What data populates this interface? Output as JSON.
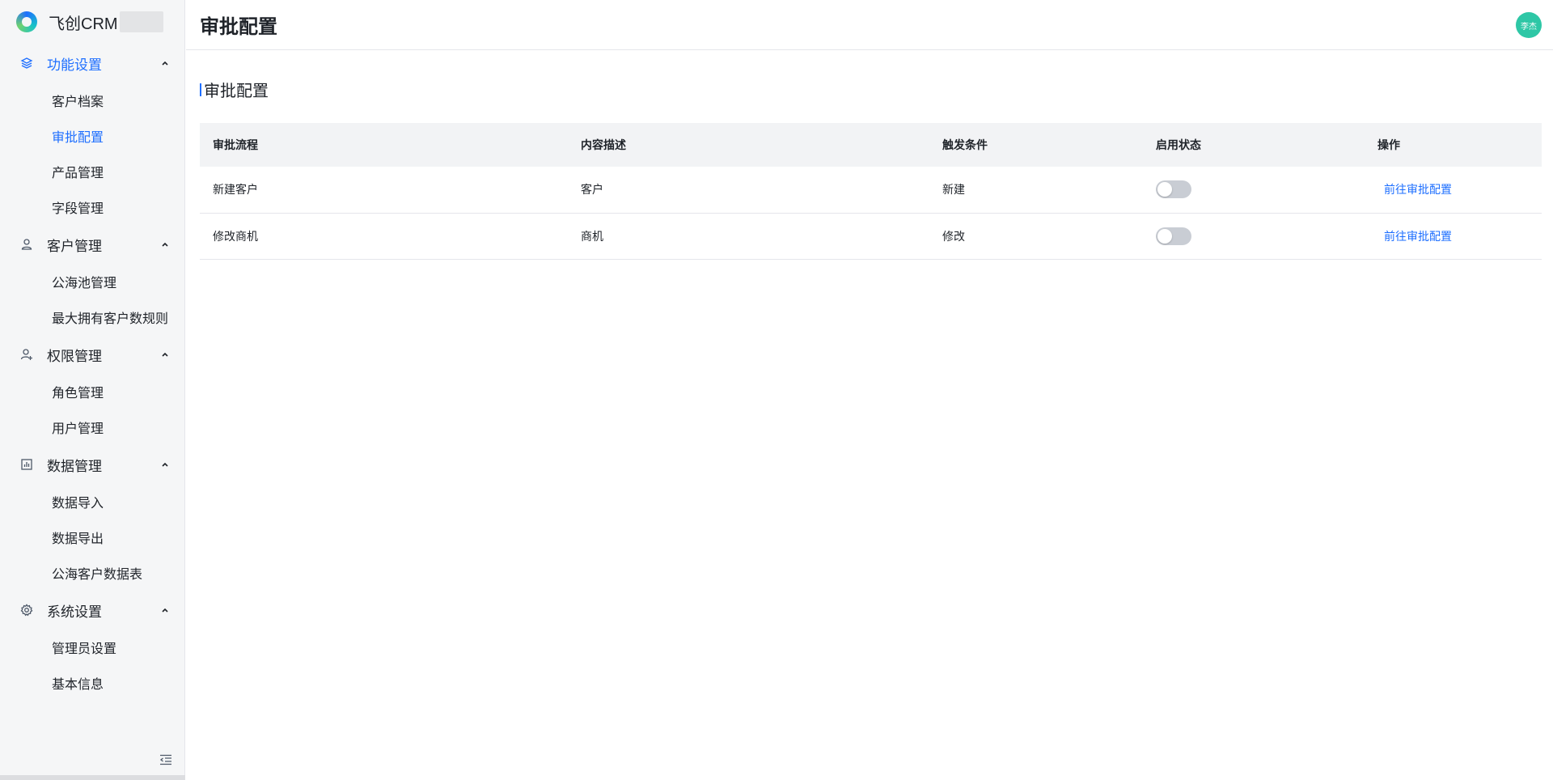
{
  "brand": {
    "name": "飞创CRM"
  },
  "sidebar": {
    "groups": [
      {
        "label": "功能设置",
        "icon": "layers-icon",
        "items": [
          "客户档案",
          "审批配置",
          "产品管理",
          "字段管理"
        ]
      },
      {
        "label": "客户管理",
        "icon": "user-icon",
        "items": [
          "公海池管理",
          "最大拥有客户数规则"
        ]
      },
      {
        "label": "权限管理",
        "icon": "user-add-icon",
        "items": [
          "角色管理",
          "用户管理"
        ]
      },
      {
        "label": "数据管理",
        "icon": "bar-chart-icon",
        "items": [
          "数据导入",
          "数据导出",
          "公海客户数据表"
        ]
      },
      {
        "label": "系统设置",
        "icon": "gear-icon",
        "items": [
          "管理员设置",
          "基本信息"
        ]
      }
    ],
    "active_group": "功能设置",
    "active_item": "审批配置"
  },
  "header": {
    "title": "审批配置",
    "avatar_text": "李杰"
  },
  "section": {
    "title": "审批配置"
  },
  "table": {
    "columns": [
      "审批流程",
      "内容描述",
      "触发条件",
      "启用状态",
      "操作"
    ],
    "rows": [
      {
        "flow": "新建客户",
        "desc": "客户",
        "trigger": "新建",
        "enabled": false,
        "action": "前往审批配置"
      },
      {
        "flow": "修改商机",
        "desc": "商机",
        "trigger": "修改",
        "enabled": false,
        "action": "前往审批配置"
      }
    ]
  },
  "colors": {
    "accent": "#1e6fff",
    "avatar": "#2ec7a6",
    "switch_off": "#c9cdd4"
  }
}
